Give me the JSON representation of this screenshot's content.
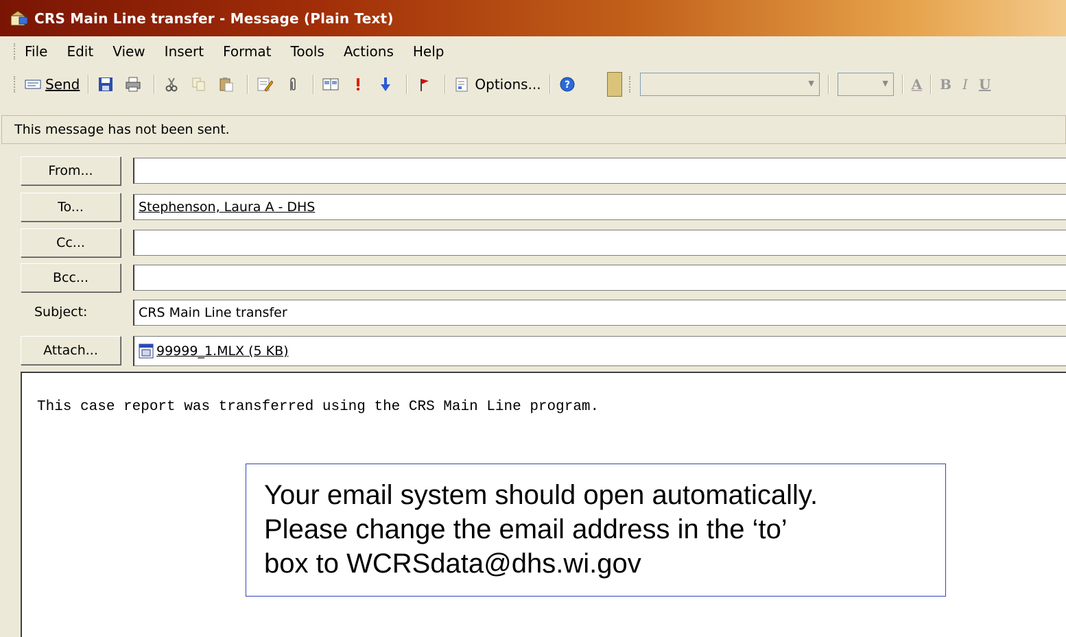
{
  "window": {
    "title": "CRS Main Line transfer - Message (Plain Text)"
  },
  "menu": [
    "File",
    "Edit",
    "View",
    "Insert",
    "Format",
    "Tools",
    "Actions",
    "Help"
  ],
  "toolbar": {
    "send_label": "Send",
    "options_label": "Options...",
    "icons": [
      "save-icon",
      "print-icon",
      "cut-icon",
      "copy-icon",
      "paste-icon",
      "spellcheck-icon",
      "attach-icon",
      "address-book-icon",
      "importance-high-icon",
      "importance-low-icon",
      "flag-icon",
      "options-icon",
      "help-icon"
    ],
    "format_buttons": [
      "A",
      "B",
      "I",
      "U"
    ]
  },
  "infobar": {
    "text": "This message has not been sent."
  },
  "fields": {
    "from_label": "From...",
    "from_value": "",
    "to_label": "To...",
    "to_value": "Stephenson, Laura A - DHS",
    "cc_label": "Cc...",
    "cc_value": "",
    "bcc_label": "Bcc...",
    "bcc_value": "",
    "subject_label": "Subject:",
    "subject_value": "CRS Main Line transfer",
    "attach_label": "Attach...",
    "attachment": "99999_1.MLX (5 KB)"
  },
  "message": {
    "body": "This case report was transferred using the CRS Main Line program."
  },
  "callout": {
    "line1": "Your email system should open automatically.",
    "line2": "Please change the email address in the ‘to’",
    "line3": "box to WCRSdata@dhs.wi.gov"
  },
  "colors": {
    "titlebar_start": "#7a1505",
    "titlebar_end": "#f3c98a",
    "chrome": "#ece9d8",
    "callout_border": "#3344aa"
  }
}
